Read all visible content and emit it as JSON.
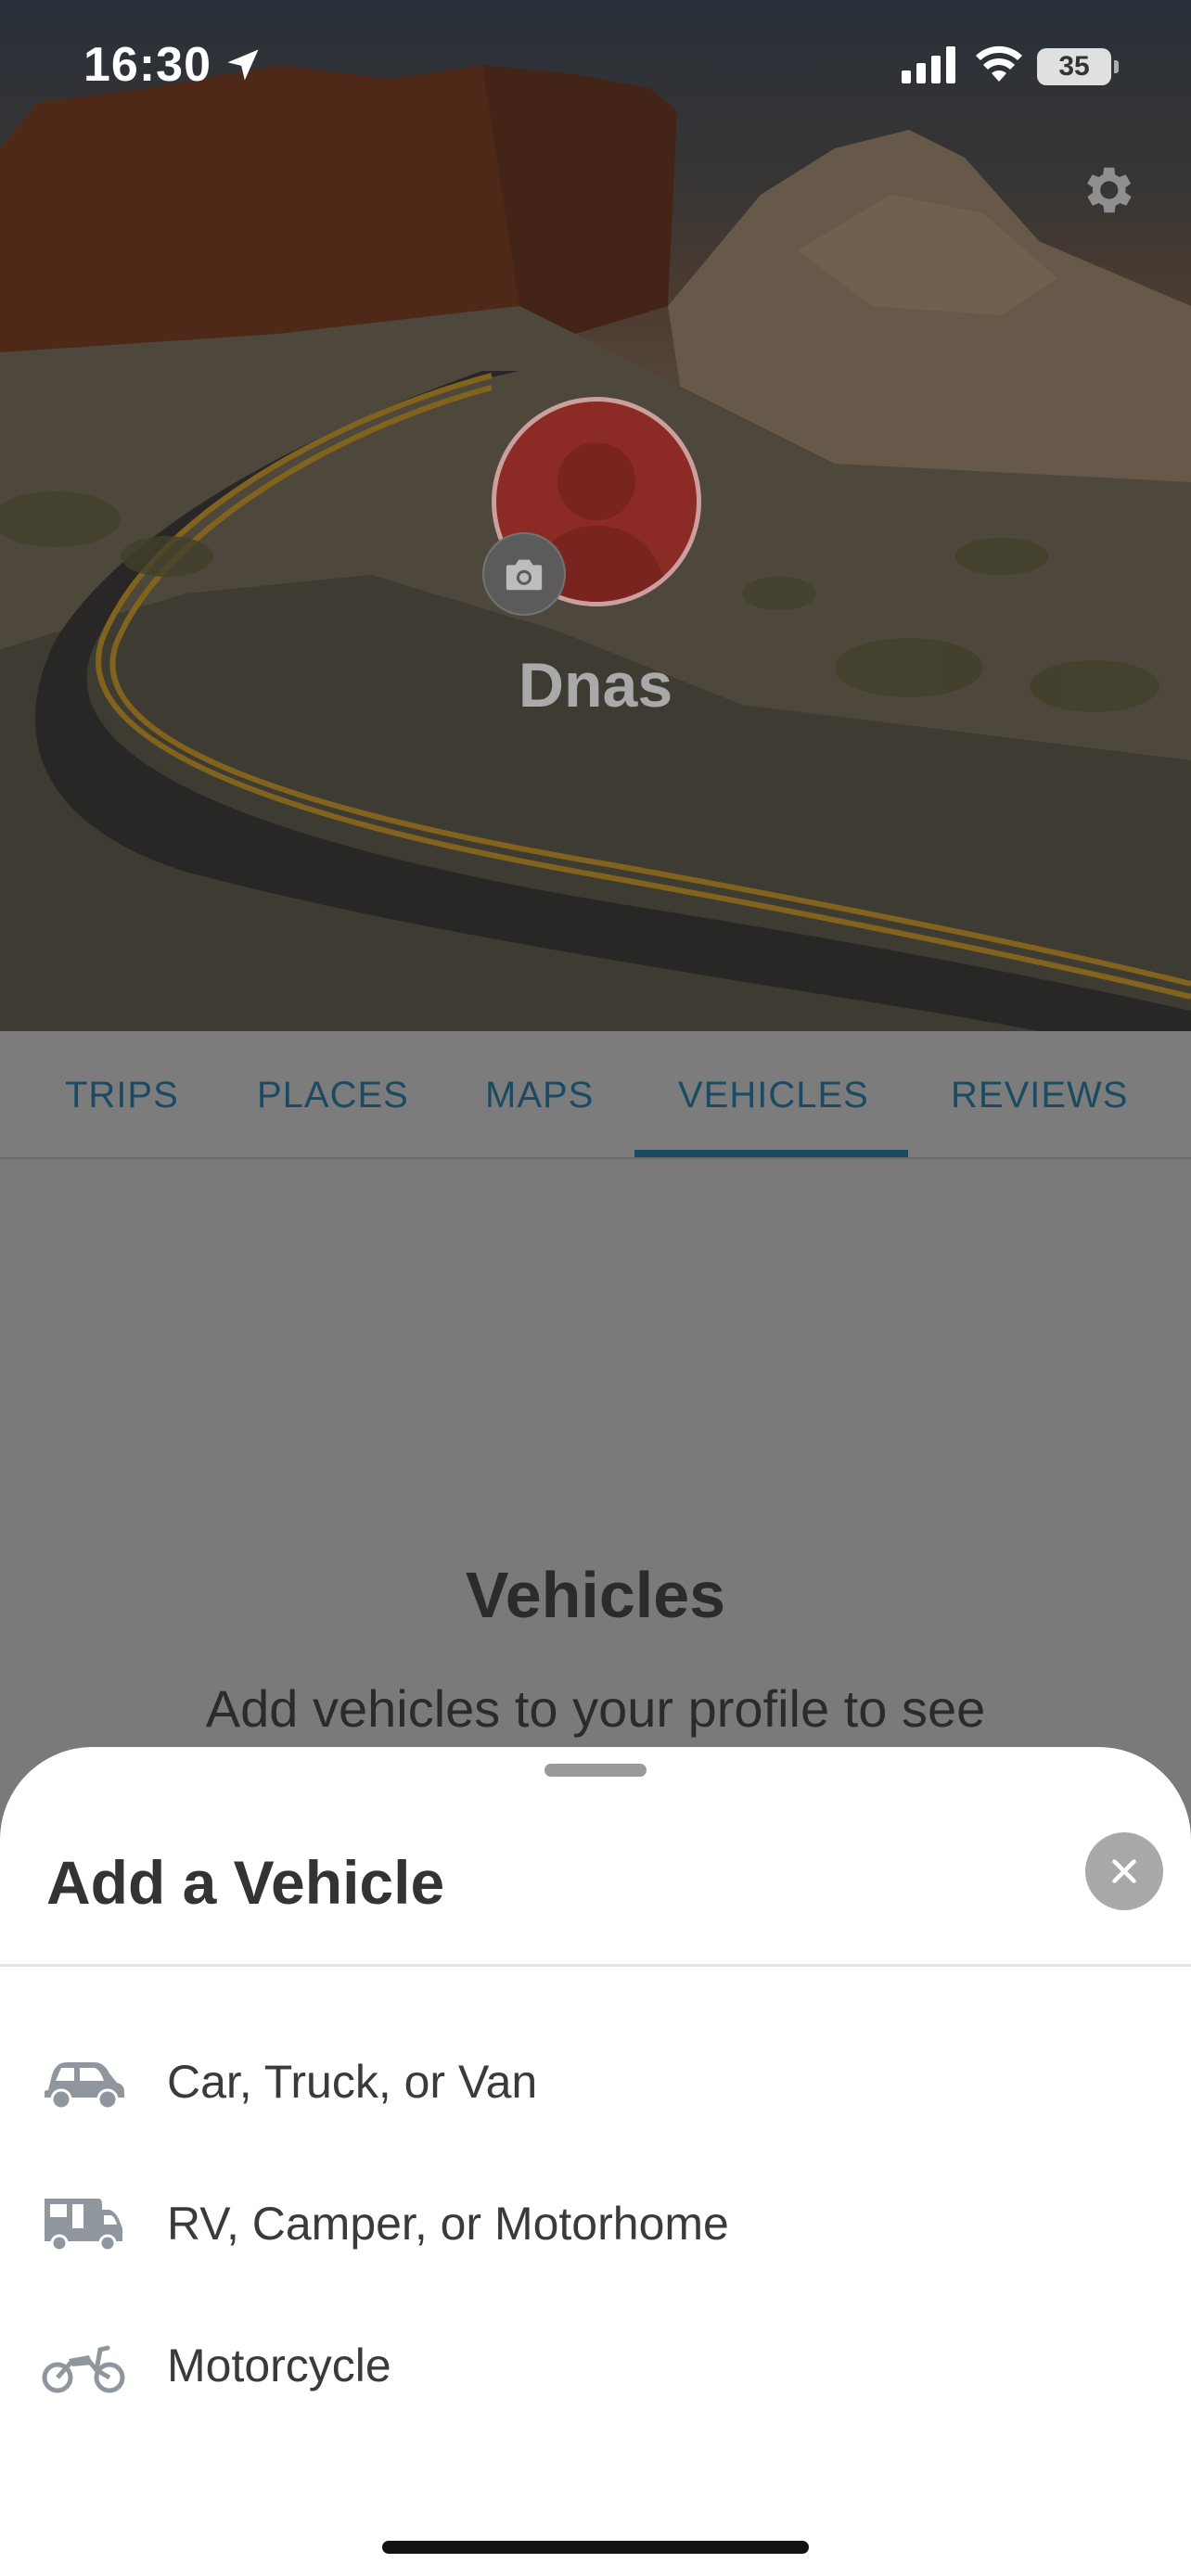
{
  "status_bar": {
    "time": "16:30",
    "battery": "35"
  },
  "profile": {
    "username": "Dnas",
    "avatar_color": "#8c2a26"
  },
  "tabs": [
    {
      "label": "TRIPS",
      "active": false
    },
    {
      "label": "PLACES",
      "active": false
    },
    {
      "label": "MAPS",
      "active": false
    },
    {
      "label": "VEHICLES",
      "active": true
    },
    {
      "label": "REVIEWS",
      "active": false
    }
  ],
  "content": {
    "title": "Vehicles",
    "description": "Add vehicles to your profile to see"
  },
  "sheet": {
    "title": "Add a Vehicle",
    "options": [
      {
        "label": "Car, Truck, or Van",
        "icon": "car-icon"
      },
      {
        "label": "RV, Camper, or Motorhome",
        "icon": "rv-icon"
      },
      {
        "label": "Motorcycle",
        "icon": "motorcycle-icon"
      }
    ]
  },
  "colors": {
    "accent": "#1b4a63",
    "icon_gray": "#8f969e"
  }
}
